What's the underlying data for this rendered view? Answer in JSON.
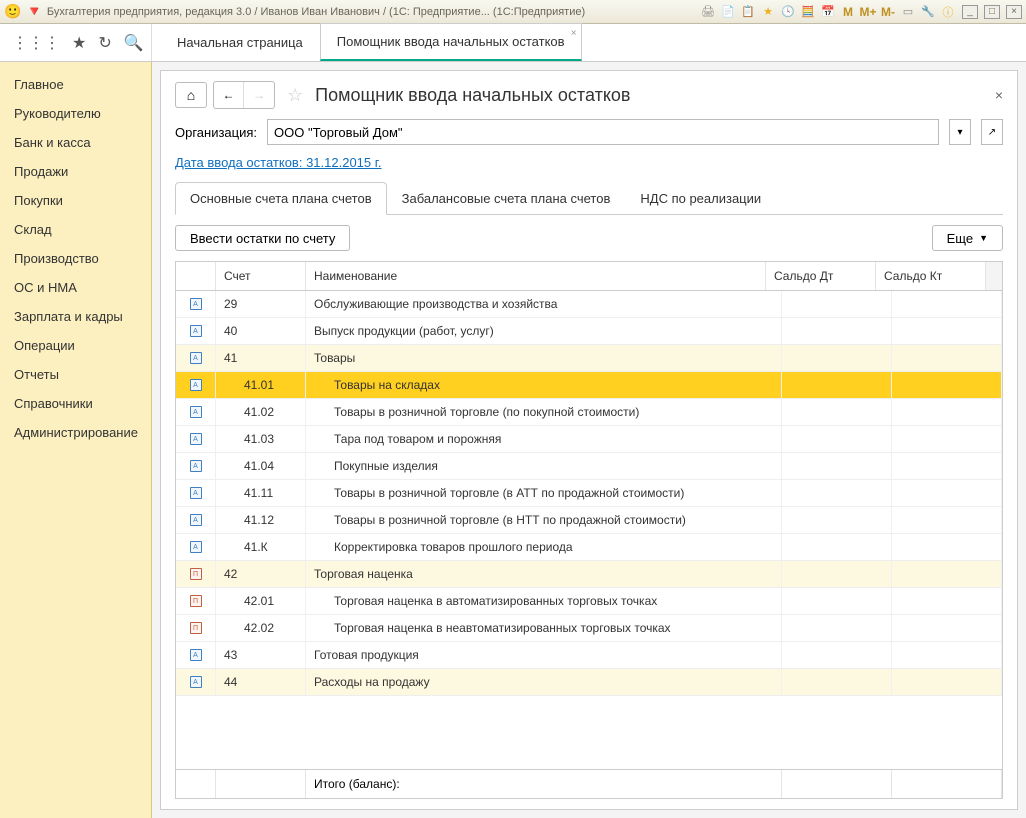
{
  "window_title": "Бухгалтерия предприятия, редакция 3.0 / Иванов Иван Иванович / (1С: Предприятие...   (1С:Предприятие)",
  "mem": {
    "m": "M",
    "mp": "M+",
    "mm": "M-"
  },
  "tabs": {
    "start": "Начальная страница",
    "assistant": "Помощник ввода начальных остатков"
  },
  "sidebar": {
    "items": [
      "Главное",
      "Руководителю",
      "Банк и касса",
      "Продажи",
      "Покупки",
      "Склад",
      "Производство",
      "ОС и НМА",
      "Зарплата и кадры",
      "Операции",
      "Отчеты",
      "Справочники",
      "Администрирование"
    ]
  },
  "panel": {
    "title": "Помощник ввода начальных остатков",
    "org_label": "Организация:",
    "org_value": "ООО \"Торговый Дом\"",
    "date_link": "Дата ввода остатков: 31.12.2015 г.",
    "subtabs": {
      "main": "Основные счета плана счетов",
      "offbalance": "Забалансовые счета плана счетов",
      "vat": "НДС по реализации"
    },
    "action_btn": "Ввести остатки по счету",
    "more_btn": "Еще"
  },
  "grid": {
    "headers": {
      "acct": "Счет",
      "name": "Наименование",
      "dt": "Сальдо Дт",
      "kt": "Сальдо Кт"
    },
    "rows": [
      {
        "acct": "29",
        "name": "Обслуживающие производства и хозяйства",
        "type": "a"
      },
      {
        "acct": "40",
        "name": "Выпуск продукции (работ, услуг)",
        "type": "a"
      },
      {
        "acct": "41",
        "name": "Товары",
        "type": "a",
        "parent": true
      },
      {
        "acct": "41.01",
        "name": "Товары на складах",
        "type": "a",
        "indent": true,
        "selected": true
      },
      {
        "acct": "41.02",
        "name": "Товары в розничной торговле (по покупной стоимости)",
        "type": "a",
        "indent": true
      },
      {
        "acct": "41.03",
        "name": "Тара под товаром и порожняя",
        "type": "a",
        "indent": true
      },
      {
        "acct": "41.04",
        "name": "Покупные изделия",
        "type": "a",
        "indent": true
      },
      {
        "acct": "41.11",
        "name": "Товары в розничной торговле (в АТТ по продажной стоимости)",
        "type": "a",
        "indent": true
      },
      {
        "acct": "41.12",
        "name": "Товары в розничной торговле (в НТТ по продажной стоимости)",
        "type": "a",
        "indent": true
      },
      {
        "acct": "41.К",
        "name": "Корректировка товаров прошлого периода",
        "type": "a",
        "indent": true
      },
      {
        "acct": "42",
        "name": "Торговая наценка",
        "type": "p",
        "parent": true
      },
      {
        "acct": "42.01",
        "name": "Торговая наценка в автоматизированных торговых точках",
        "type": "p",
        "indent": true
      },
      {
        "acct": "42.02",
        "name": "Торговая наценка в неавтоматизированных торговых точках",
        "type": "p",
        "indent": true
      },
      {
        "acct": "43",
        "name": "Готовая продукция",
        "type": "a"
      },
      {
        "acct": "44",
        "name": "Расходы на продажу",
        "type": "a",
        "parent": true
      }
    ],
    "footer": "Итого (баланс):"
  }
}
